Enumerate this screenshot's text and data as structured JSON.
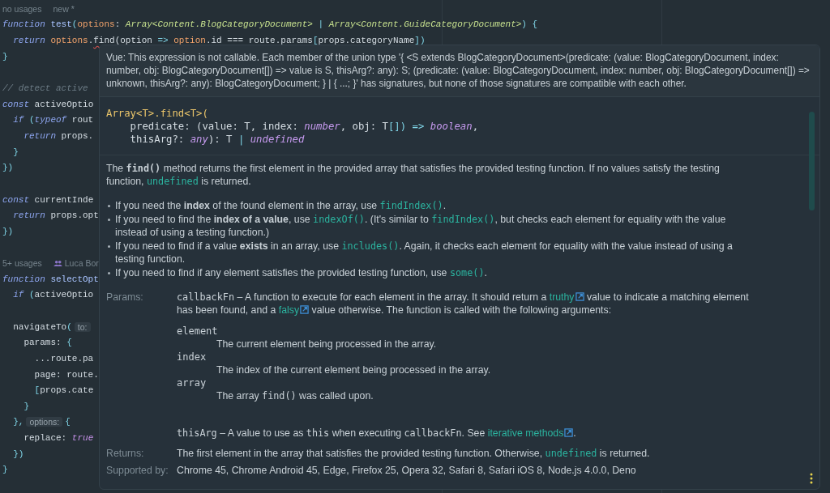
{
  "editor": {
    "lines": [
      {
        "kind": "meta",
        "items": [
          {
            "kind": "usage",
            "t": "no usages"
          },
          {
            "kind": "usage",
            "t": "new *"
          }
        ]
      },
      {
        "kind": "code",
        "tokens": [
          {
            "kind": "kw",
            "t": "function"
          },
          {
            "kind": "fn",
            "t": " test"
          },
          {
            "kind": "punct",
            "t": "("
          },
          {
            "kind": "param",
            "t": "options"
          },
          {
            "kind": "plain",
            "t": ": "
          },
          {
            "kind": "type",
            "t": "Array<Content.BlogCategoryDocument>"
          },
          {
            "kind": "punct",
            "t": " | "
          },
          {
            "kind": "type",
            "t": "Array<Content.GuideCategoryDocument>"
          },
          {
            "kind": "punct",
            "t": ") {"
          }
        ]
      },
      {
        "kind": "code",
        "tokens": [
          {
            "kind": "kw",
            "t": "  return"
          },
          {
            "kind": "param",
            "t": " options"
          },
          {
            "kind": "plain",
            "t": "."
          },
          {
            "kind": "err",
            "t": "find(option"
          },
          {
            "kind": "punct",
            "t": " => "
          },
          {
            "kind": "param",
            "t": "option"
          },
          {
            "kind": "plain",
            "t": ".id === route.params"
          },
          {
            "kind": "punct",
            "t": "["
          },
          {
            "kind": "plain",
            "t": "props.categoryName"
          },
          {
            "kind": "punct",
            "t": "])"
          }
        ]
      },
      {
        "kind": "code",
        "tokens": [
          {
            "kind": "punct",
            "t": "}"
          }
        ]
      },
      {
        "kind": "blank"
      },
      {
        "kind": "code",
        "tokens": [
          {
            "kind": "comment",
            "t": "// detect active"
          }
        ]
      },
      {
        "kind": "code",
        "tokens": [
          {
            "kind": "kw",
            "t": "const"
          },
          {
            "kind": "plain",
            "t": " activeOptio"
          }
        ]
      },
      {
        "kind": "code",
        "tokens": [
          {
            "kind": "kw",
            "t": "  if"
          },
          {
            "kind": "punct",
            "t": " ("
          },
          {
            "kind": "kw",
            "t": "typeof"
          },
          {
            "kind": "plain",
            "t": " rout"
          }
        ]
      },
      {
        "kind": "code",
        "tokens": [
          {
            "kind": "kw",
            "t": "    return"
          },
          {
            "kind": "plain",
            "t": " props."
          }
        ]
      },
      {
        "kind": "code",
        "tokens": [
          {
            "kind": "punct",
            "t": "  }"
          }
        ]
      },
      {
        "kind": "code",
        "tokens": [
          {
            "kind": "punct",
            "t": "})"
          }
        ]
      },
      {
        "kind": "blank"
      },
      {
        "kind": "code",
        "tokens": [
          {
            "kind": "kw",
            "t": "const"
          },
          {
            "kind": "plain",
            "t": " currentInde"
          }
        ]
      },
      {
        "kind": "code",
        "tokens": [
          {
            "kind": "kw",
            "t": "  return"
          },
          {
            "kind": "plain",
            "t": " props.opt"
          }
        ]
      },
      {
        "kind": "code",
        "tokens": [
          {
            "kind": "punct",
            "t": "})"
          }
        ]
      },
      {
        "kind": "blank"
      },
      {
        "kind": "meta",
        "items": [
          {
            "kind": "usage",
            "t": "5+ usages"
          },
          {
            "kind": "author",
            "t": "Luca Bor"
          }
        ]
      },
      {
        "kind": "code",
        "tokens": [
          {
            "kind": "kw",
            "t": "function"
          },
          {
            "kind": "fn",
            "t": " selectOpt"
          }
        ]
      },
      {
        "kind": "code",
        "tokens": [
          {
            "kind": "kw",
            "t": "  if"
          },
          {
            "kind": "punct",
            "t": " ("
          },
          {
            "kind": "plain",
            "t": "activeOptio"
          }
        ]
      },
      {
        "kind": "blank"
      },
      {
        "kind": "code",
        "tokens": [
          {
            "kind": "plain",
            "t": "  navigateTo"
          },
          {
            "kind": "punct",
            "t": "("
          },
          {
            "kind": "hint",
            "t": "to:"
          }
        ]
      },
      {
        "kind": "code",
        "tokens": [
          {
            "kind": "plain",
            "t": "    params: "
          },
          {
            "kind": "punct",
            "t": "{"
          }
        ]
      },
      {
        "kind": "code",
        "tokens": [
          {
            "kind": "plain",
            "t": "      ...route.pa"
          }
        ]
      },
      {
        "kind": "code",
        "tokens": [
          {
            "kind": "plain",
            "t": "      page: route."
          }
        ]
      },
      {
        "kind": "code",
        "tokens": [
          {
            "kind": "punct",
            "t": "      ["
          },
          {
            "kind": "plain",
            "t": "props.cate"
          }
        ]
      },
      {
        "kind": "code",
        "tokens": [
          {
            "kind": "punct",
            "t": "    }"
          }
        ]
      },
      {
        "kind": "code",
        "tokens": [
          {
            "kind": "punct",
            "t": "  },"
          },
          {
            "kind": "hint",
            "t": "options:"
          },
          {
            "kind": "punct",
            "t": "{"
          }
        ]
      },
      {
        "kind": "code",
        "tokens": [
          {
            "kind": "plain",
            "t": "    replace: "
          },
          {
            "kind": "bool",
            "t": "true"
          }
        ]
      },
      {
        "kind": "code",
        "tokens": [
          {
            "kind": "punct",
            "t": "  })"
          }
        ]
      },
      {
        "kind": "code",
        "tokens": [
          {
            "kind": "punct",
            "t": "}"
          }
        ]
      }
    ]
  },
  "popup": {
    "error": "Vue: This expression is not callable. Each member of the union type '{ <S extends BlogCategoryDocument>(predicate: (value: BlogCategoryDocument, index: number, obj: BlogCategoryDocument[]) => value is S, thisArg?: any): S; (predicate: (value: BlogCategoryDocument, index: number, obj: BlogCategoryDocument[]) => unknown, thisArg?: any): BlogCategoryDocument; } | { ...; }' has signatures, but none of those signatures are compatible with each other.",
    "signature": [
      [
        {
          "kind": "name",
          "t": "Array<T>.find<T>("
        }
      ],
      [
        {
          "kind": "plain",
          "t": "    predicate: (value: T, index: "
        },
        {
          "kind": "tkw",
          "t": "number"
        },
        {
          "kind": "plain",
          "t": ", obj: T"
        },
        {
          "kind": "punct",
          "t": "[]) =>"
        },
        {
          "kind": "tkw",
          "t": " boolean"
        },
        {
          "kind": "plain",
          "t": ","
        }
      ],
      [
        {
          "kind": "plain",
          "t": "    thisArg?: "
        },
        {
          "kind": "tkw",
          "t": "any"
        },
        {
          "kind": "plain",
          "t": "): T "
        },
        {
          "kind": "punct",
          "t": "|"
        },
        {
          "kind": "tkw",
          "t": " undefined"
        }
      ]
    ],
    "description": [
      {
        "t": "The "
      },
      {
        "kind": "code-bold",
        "t": "find()"
      },
      {
        "t": " method returns the first element in the provided array that satisfies the provided testing function. If no values satisfy the testing function, "
      },
      {
        "kind": "code",
        "t": "undefined"
      },
      {
        "t": " is returned."
      }
    ],
    "bullets": [
      [
        {
          "t": "If you need the "
        },
        {
          "kind": "bold",
          "t": "index"
        },
        {
          "t": " of the found element in the array, use "
        },
        {
          "kind": "code",
          "t": "findIndex()"
        },
        {
          "t": "."
        }
      ],
      [
        {
          "t": "If you need to find the "
        },
        {
          "kind": "bold",
          "t": "index of a value"
        },
        {
          "t": ", use "
        },
        {
          "kind": "code",
          "t": "indexOf()"
        },
        {
          "t": ". (It's similar to "
        },
        {
          "kind": "code",
          "t": "findIndex()"
        },
        {
          "t": ", but checks each element for equality with the value instead of using a testing function.)"
        }
      ],
      [
        {
          "t": "If you need to find if a value "
        },
        {
          "kind": "bold",
          "t": "exists"
        },
        {
          "t": " in an array, use "
        },
        {
          "kind": "code",
          "t": "includes()"
        },
        {
          "t": ". Again, it checks each element for equality with the value instead of using a testing function."
        }
      ],
      [
        {
          "t": "If you need to find if any element satisfies the provided testing function, use "
        },
        {
          "kind": "code",
          "t": "some()"
        },
        {
          "t": "."
        }
      ]
    ],
    "params": {
      "label": "Params:",
      "text": [
        {
          "kind": "mono",
          "t": "callbackFn"
        },
        {
          "t": " – A function to execute for each element in the array. It should return a "
        },
        {
          "kind": "link",
          "t": "truthy"
        },
        {
          "t": " value to indicate a matching element has been found, and a "
        },
        {
          "kind": "link",
          "t": "falsy"
        },
        {
          "t": " value otherwise. The function is called with the following arguments:"
        }
      ],
      "arguments": [
        {
          "name": "element",
          "description": [
            {
              "t": "The current element being processed in the array."
            }
          ]
        },
        {
          "name": "index",
          "description": [
            {
              "t": "The index of the current element being processed in the array."
            }
          ]
        },
        {
          "name": "array",
          "description": [
            {
              "t": "The array "
            },
            {
              "kind": "mono",
              "t": "find()"
            },
            {
              "t": " was called upon."
            }
          ]
        }
      ],
      "extra": [
        {
          "kind": "mono",
          "t": "thisArg"
        },
        {
          "t": " – A value to use as "
        },
        {
          "kind": "mono",
          "t": "this"
        },
        {
          "t": " when executing "
        },
        {
          "kind": "mono",
          "t": "callbackFn"
        },
        {
          "t": ". See "
        },
        {
          "kind": "link",
          "t": "iterative methods"
        },
        {
          "t": "."
        }
      ]
    },
    "returns": {
      "label": "Returns:",
      "text": [
        {
          "t": "The first element in the array that satisfies the provided testing function. Otherwise, "
        },
        {
          "kind": "code",
          "t": "undefined"
        },
        {
          "t": " is returned."
        }
      ]
    },
    "supported": {
      "label": "Supported by:",
      "text": "Chrome 45, Chrome Android 45, Edge, Firefox 25, Opera 32, Safari 8, Safari iOS 8, Node.js 4.0.0, Deno"
    }
  }
}
